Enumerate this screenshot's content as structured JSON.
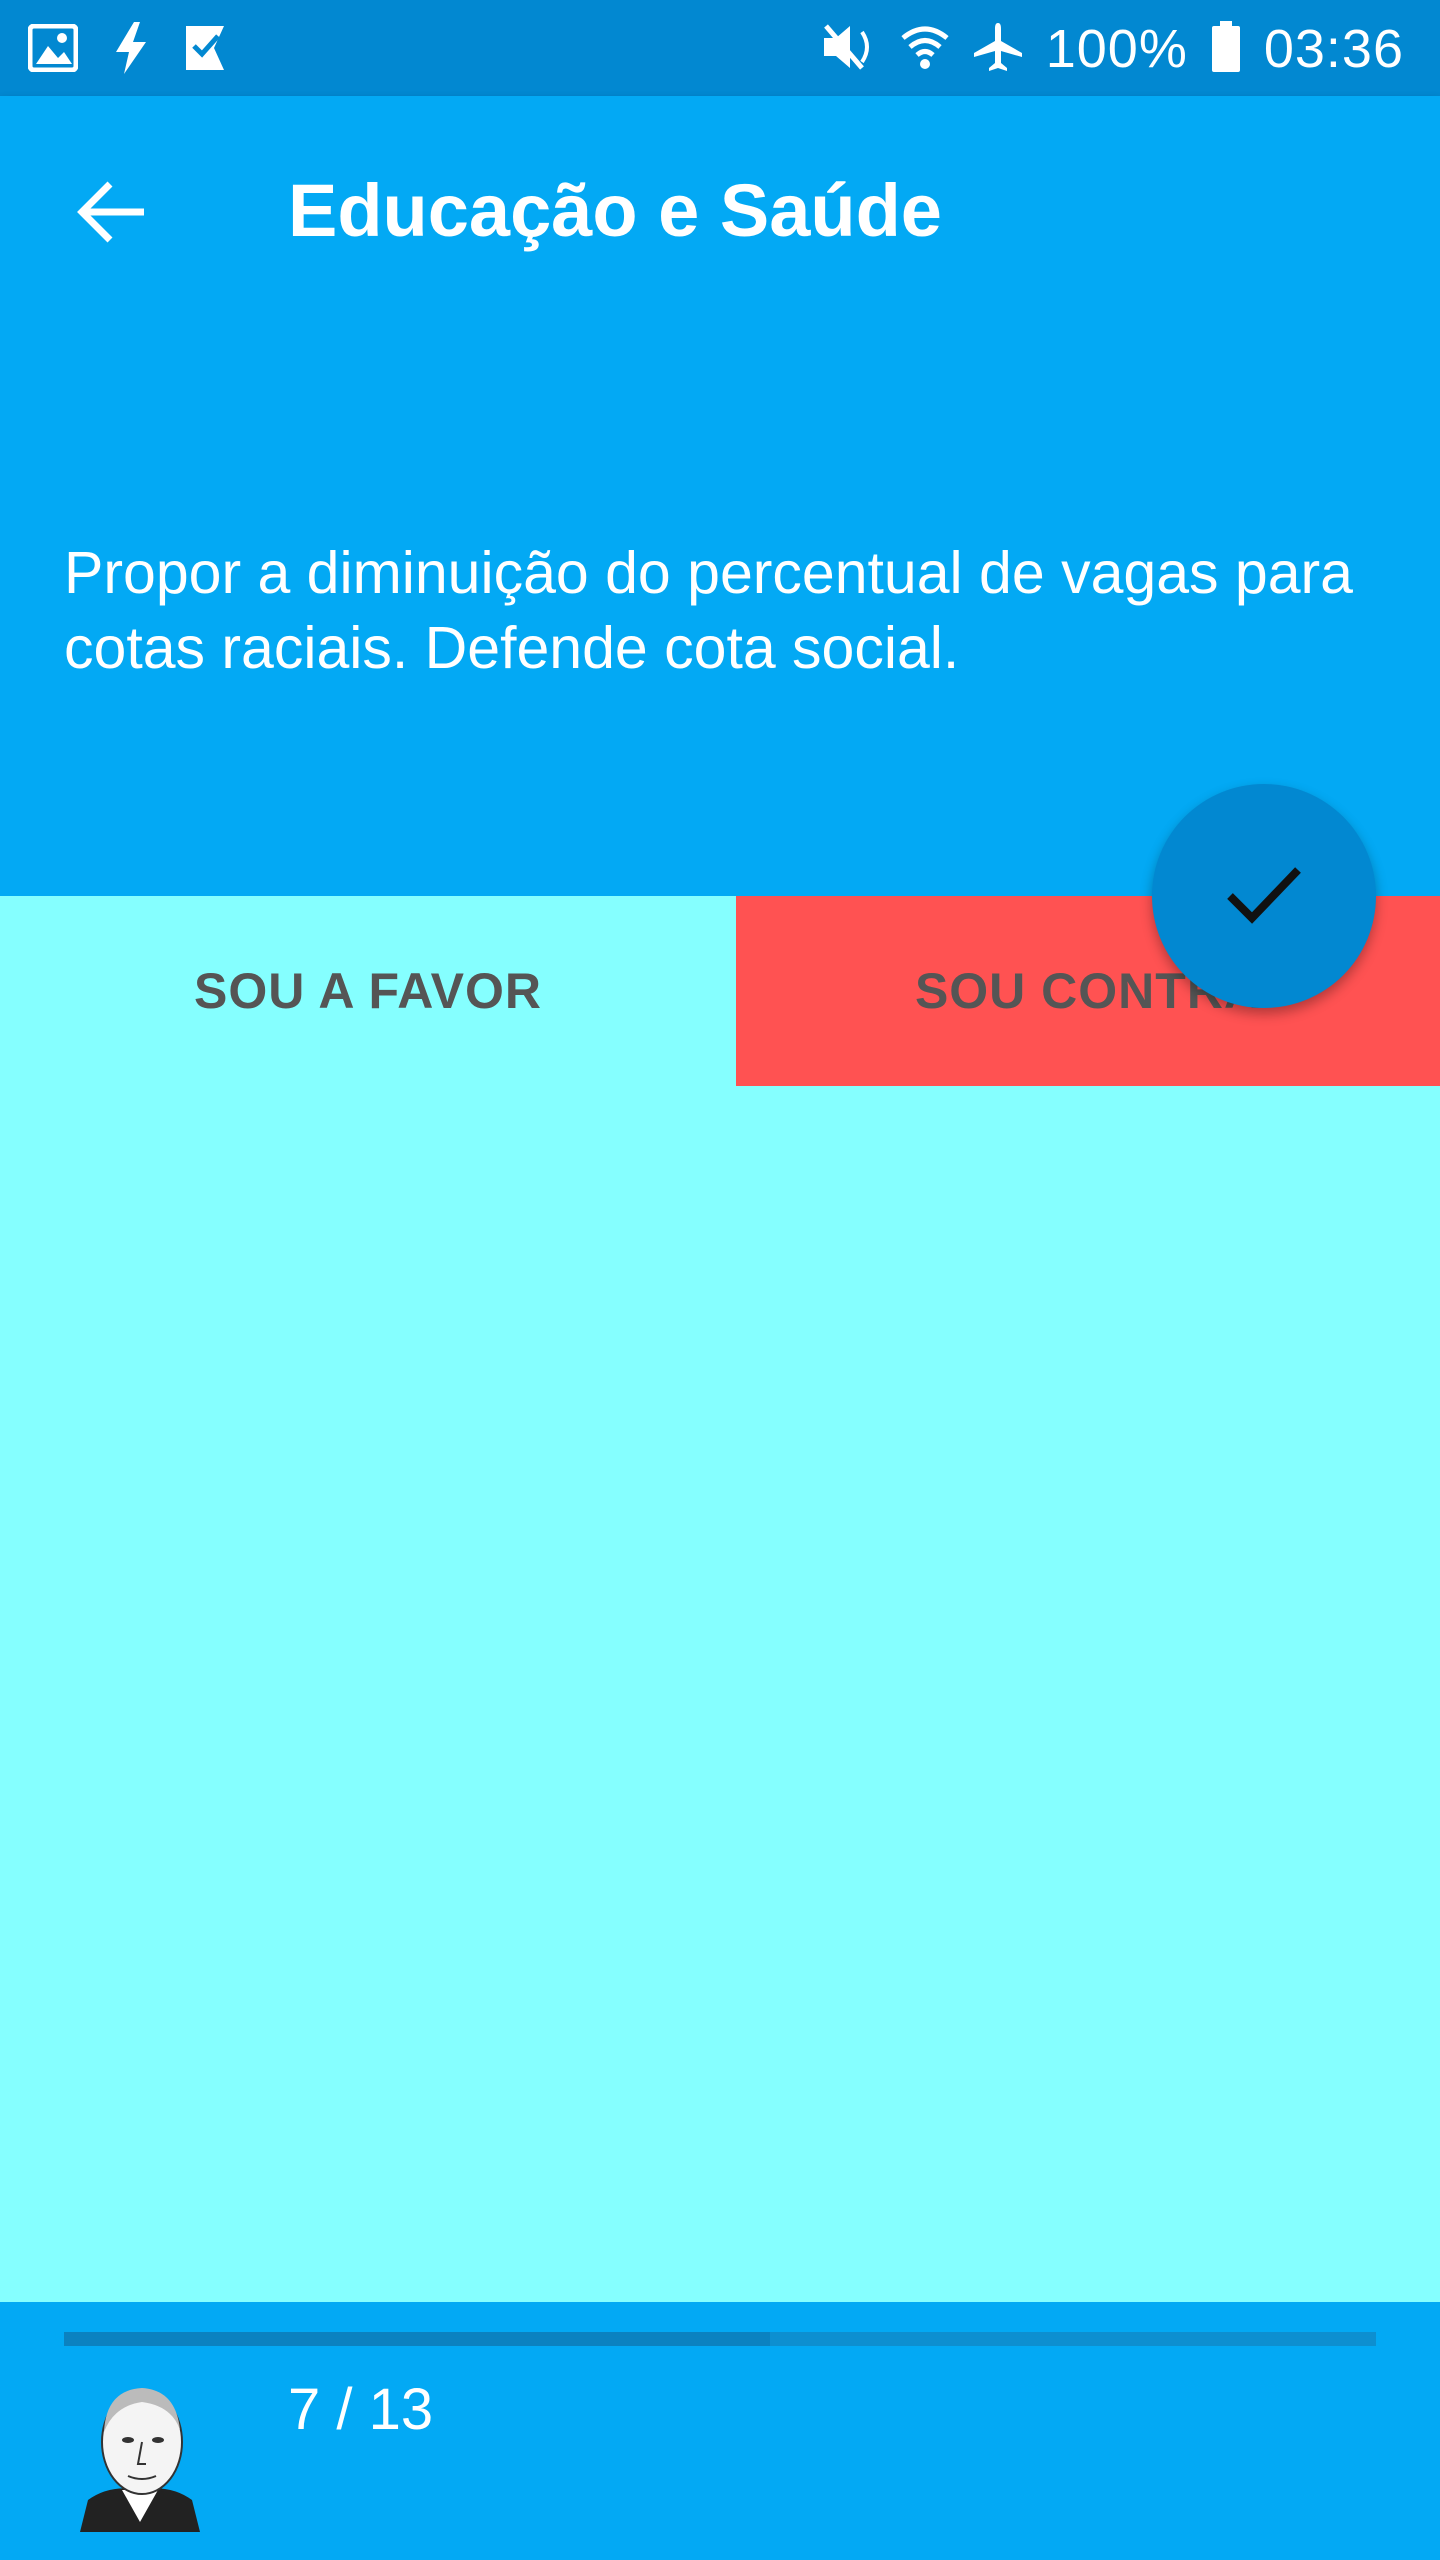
{
  "status_bar": {
    "battery": "100%",
    "time": "03:36",
    "icons": [
      "gallery-icon",
      "flash-icon",
      "task-check-icon",
      "mute-icon",
      "wifi-icon",
      "airplane-icon",
      "battery-icon"
    ]
  },
  "header": {
    "title": "Educação e Saúde",
    "back_icon": "arrow-back-icon"
  },
  "proposal": {
    "text": "Propor a diminuição do percentual de vagas para cotas raciais. Defende cota social."
  },
  "choices": {
    "favor_label": "SOU A FAVOR",
    "contra_label": "SOU CONTRA",
    "selected": "contra"
  },
  "fab": {
    "icon": "check-icon"
  },
  "footer": {
    "counter": "7 / 13",
    "progress_fraction": 0.538
  },
  "colors": {
    "status_bar": "#0288d1",
    "primary": "#03a9f4",
    "background": "#85ffff",
    "contra_selected": "#ff5252",
    "fab": "#0288d1"
  }
}
